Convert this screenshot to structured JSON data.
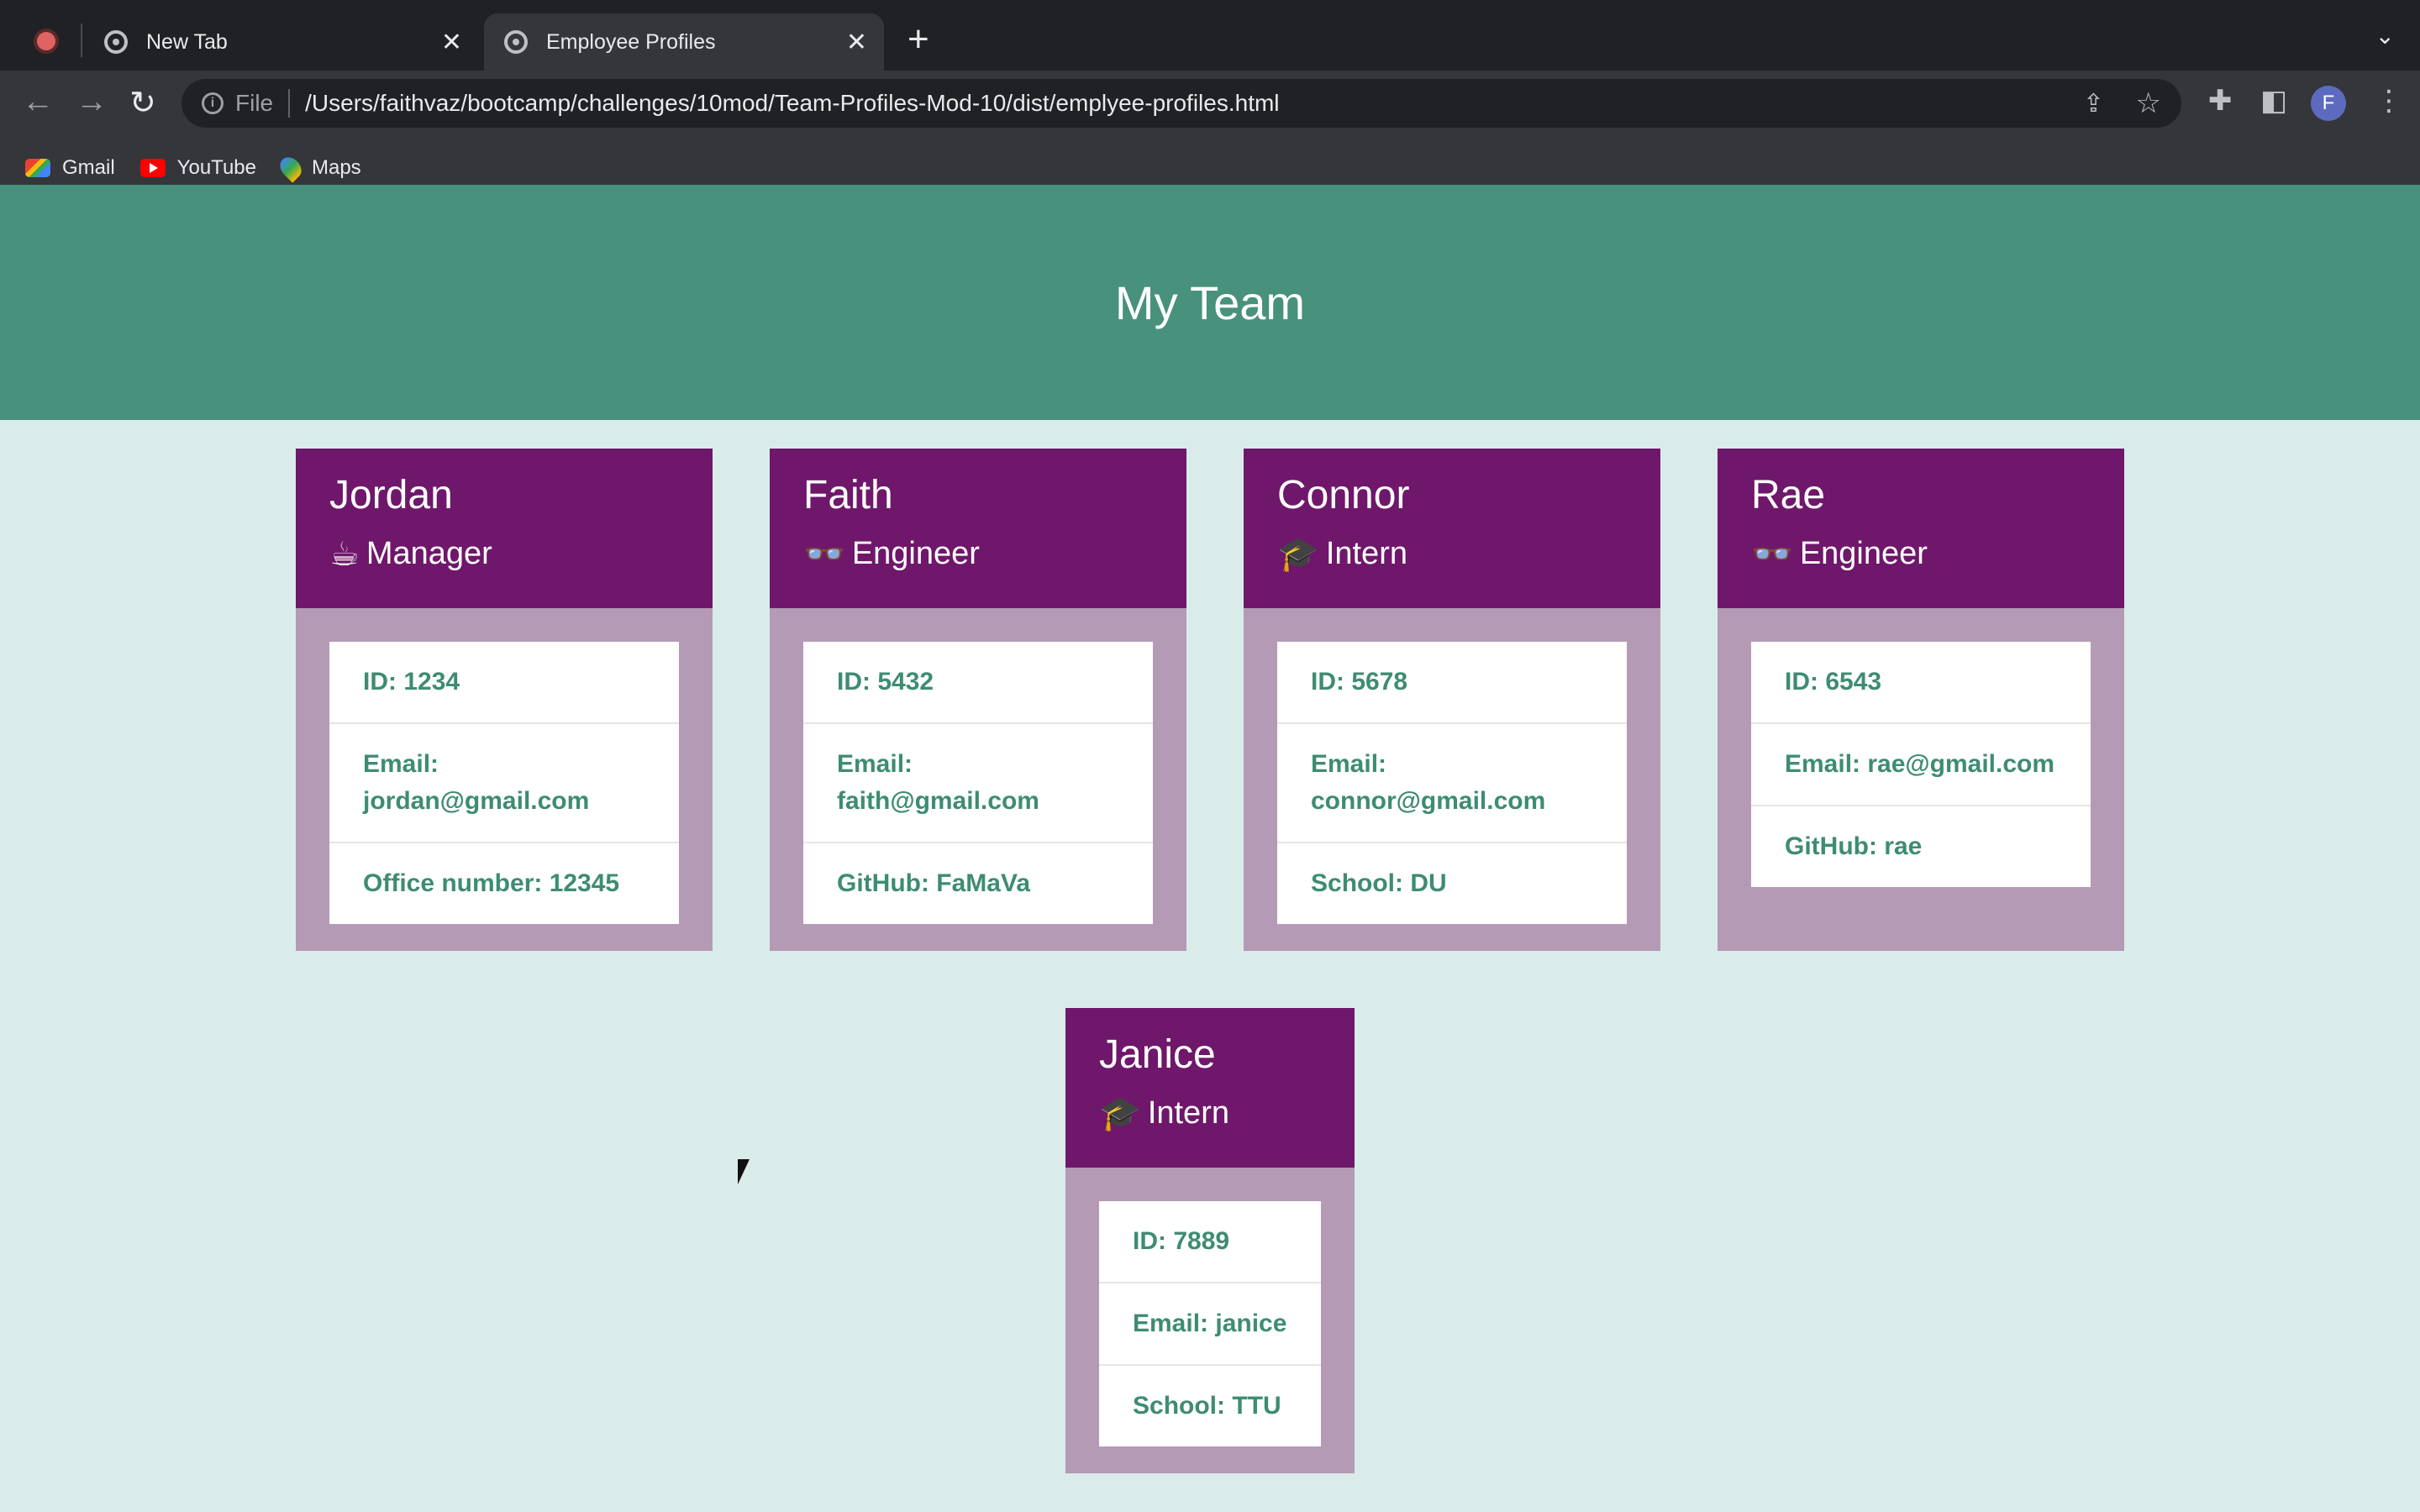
{
  "browser": {
    "tabs": [
      {
        "title": "New Tab",
        "active": false
      },
      {
        "title": "Employee Profiles",
        "active": true
      }
    ],
    "address": {
      "scheme_label": "File",
      "url": "/Users/faithvaz/bootcamp/challenges/10mod/Team-Profiles-Mod-10/dist/emplyee-profiles.html"
    },
    "profile_initial": "F",
    "bookmarks": [
      {
        "label": "Gmail",
        "icon": "gmail-icon"
      },
      {
        "label": "YouTube",
        "icon": "youtube-icon"
      },
      {
        "label": "Maps",
        "icon": "maps-icon"
      }
    ]
  },
  "page": {
    "title": "My Team",
    "colors": {
      "header": "#48917d",
      "card_head": "#6f176b",
      "card_body": "#b59ab5",
      "text_accent": "#3e8c72"
    },
    "employees": [
      {
        "name": "Jordan",
        "role": "Manager",
        "role_icon": "coffee-mug-icon",
        "rows": [
          "ID: 1234",
          "Email: jordan@gmail.com",
          "Office number: 12345"
        ]
      },
      {
        "name": "Faith",
        "role": "Engineer",
        "role_icon": "glasses-icon",
        "rows": [
          "ID: 5432",
          "Email: faith@gmail.com",
          "GitHub: FaMaVa"
        ]
      },
      {
        "name": "Connor",
        "role": "Intern",
        "role_icon": "graduate-icon",
        "rows": [
          "ID: 5678",
          "Email: connor@gmail.com",
          "School: DU"
        ]
      },
      {
        "name": "Rae",
        "role": "Engineer",
        "role_icon": "glasses-icon",
        "rows": [
          "ID: 6543",
          "Email: rae@gmail.com",
          "GitHub: rae"
        ]
      },
      {
        "name": "Janice",
        "role": "Intern",
        "role_icon": "graduate-icon",
        "rows": [
          "ID: 7889",
          "Email: janice",
          "School: TTU"
        ]
      }
    ]
  }
}
